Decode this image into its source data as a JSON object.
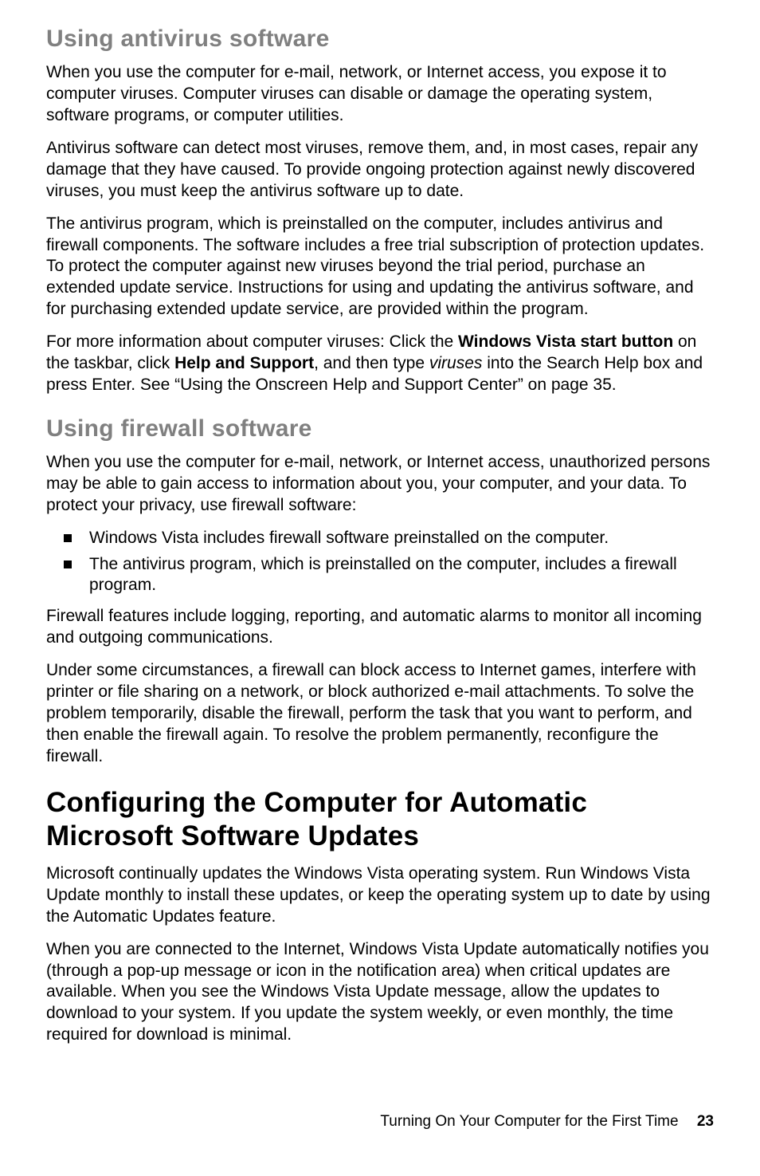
{
  "section1": {
    "heading": "Using antivirus software",
    "p1": "When you use the computer for e-mail, network, or Internet access, you expose it to computer viruses. Computer viruses can disable or damage the operating system, software programs, or computer utilities.",
    "p2": "Antivirus software can detect most viruses, remove them, and, in most cases, repair any damage that they have caused. To provide ongoing protection against newly discovered viruses, you must keep the antivirus software up to date.",
    "p3": "The antivirus program, which is preinstalled on the computer, includes antivirus and firewall components. The software includes a free trial subscription of protection updates. To protect the computer against new viruses beyond the trial period, purchase an extended update service. Instructions for using and updating the antivirus software, and for purchasing extended update service, are provided within the program.",
    "p4_a": "For more information about computer viruses: Click the ",
    "p4_b": "Windows Vista start button",
    "p4_c": " on the taskbar, click ",
    "p4_d": "Help and Support",
    "p4_e": ", and then type ",
    "p4_f": "viruses",
    "p4_g": " into the Search Help box and press Enter. See “Using the Onscreen Help and Support Center” on page 35."
  },
  "section2": {
    "heading": "Using firewall software",
    "p1": "When you use the computer for e-mail, network, or Internet access, unauthorized persons may be able to gain access to information about you, your computer, and your data. To protect your privacy, use firewall software:",
    "bullets": [
      "Windows Vista includes firewall software preinstalled on the computer.",
      "The antivirus program, which is preinstalled on the computer, includes a firewall program."
    ],
    "p2": "Firewall features include logging, reporting, and automatic alarms to monitor all incoming and outgoing communications.",
    "p3": "Under some circumstances, a firewall can block access to Internet games, interfere with printer or file sharing on a network, or block authorized e-mail attachments. To solve the problem temporarily, disable the firewall, perform the task that you want to perform, and then enable the firewall again. To resolve the problem permanently, reconfigure the firewall."
  },
  "section3": {
    "heading": "Configuring the Computer for Automatic Microsoft Software Updates",
    "p1": "Microsoft continually updates the Windows Vista operating system. Run Windows Vista Update monthly to install these updates, or keep the operating system up to date by using the Automatic Updates feature.",
    "p2": "When you are connected to the Internet, Windows Vista Update automatically notifies you (through a pop-up message or icon in the notification area) when critical updates are available. When you see the Windows Vista Update message, allow the updates to download to your system. If you update the system weekly, or even monthly, the time required for download is minimal."
  },
  "footer": {
    "section_title": "Turning On Your Computer for the First Time",
    "page_number": "23"
  }
}
